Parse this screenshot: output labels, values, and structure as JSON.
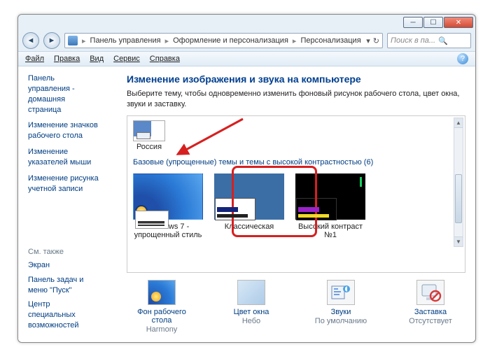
{
  "window": {
    "min_tip": "Свернуть",
    "max_tip": "Развернуть",
    "close_tip": "Закрыть"
  },
  "breadcrumbs": {
    "root": "Панель управления",
    "mid": "Оформление и персонализация",
    "leaf": "Персонализация"
  },
  "search": {
    "placeholder": "Поиск в па..."
  },
  "menu": {
    "file": "Файл",
    "edit": "Правка",
    "view": "Вид",
    "service": "Сервис",
    "help": "Справка"
  },
  "sidebar": {
    "items": [
      "Панель управления - домашняя страница",
      "Изменение значков рабочего стола",
      "Изменение указателей мыши",
      "Изменение рисунка учетной записи"
    ],
    "see_also_header": "См. также",
    "see_also": [
      "Экран",
      "Панель задач и меню \"Пуск\"",
      "Центр специальных возможностей"
    ]
  },
  "main": {
    "title": "Изменение изображения и звука на компьютере",
    "desc": "Выберите тему, чтобы одновременно изменить фоновый рисунок рабочего стола, цвет окна, звуки и заставку.",
    "prev_theme": "Россия",
    "category_label": "Базовые (упрощенные) темы и темы с высокой контрастностью (6)",
    "themes": {
      "win7": "Windows 7 - упрощенный стиль",
      "classic": "Классическая",
      "hc1": "Высокий контраст №1"
    }
  },
  "footer": {
    "bg": {
      "label": "Фон рабочего стола",
      "value": "Harmony"
    },
    "color": {
      "label": "Цвет окна",
      "value": "Небо"
    },
    "sound": {
      "label": "Звуки",
      "value": "По умолчанию"
    },
    "saver": {
      "label": "Заставка",
      "value": "Отсутствует"
    }
  }
}
